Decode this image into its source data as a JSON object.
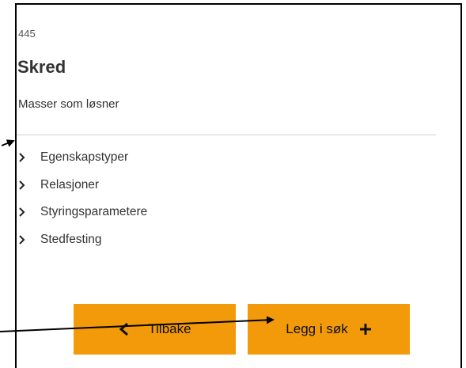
{
  "object": {
    "id": "445",
    "title": "Skred",
    "description": "Masser som løsner"
  },
  "sections": [
    {
      "label": "Egenskapstyper",
      "icon": "chevron-right-icon"
    },
    {
      "label": "Relasjoner",
      "icon": "chevron-right-icon"
    },
    {
      "label": "Styringsparametere",
      "icon": "chevron-right-icon"
    },
    {
      "label": "Stedfesting",
      "icon": "chevron-right-icon"
    }
  ],
  "buttons": {
    "back_label": "Tilbake",
    "back_icon": "arrow-left-icon",
    "add_label": "Legg i søk",
    "add_icon": "plus-icon"
  },
  "colors": {
    "button_bg": "#f29a0a",
    "divider": "#cfcfcf",
    "text": "#333333",
    "annotation_arrow": "#000000"
  }
}
